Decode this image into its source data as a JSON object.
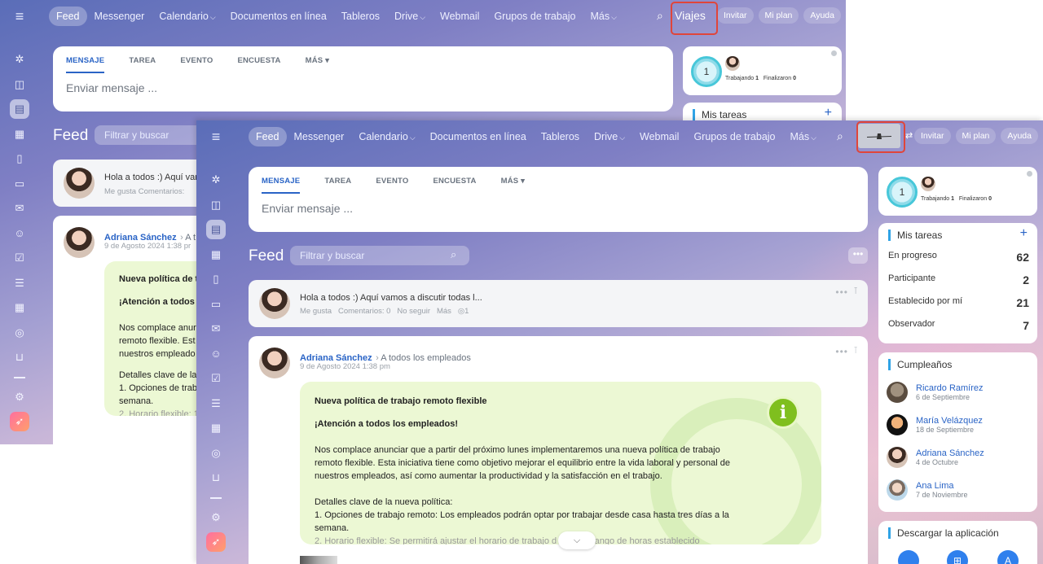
{
  "nav": {
    "items": [
      "Feed",
      "Messenger",
      "Calendario",
      "Documentos en línea",
      "Tableros",
      "Drive",
      "Webmail",
      "Grupos de trabajo",
      "Más"
    ],
    "invitar": "Invitar",
    "mi_plan": "Mi plan",
    "ayuda": "Ayuda"
  },
  "back_logo": "Viajes",
  "composer": {
    "tabs": [
      "MENSAJE",
      "TAREA",
      "EVENTO",
      "ENCUESTA",
      "MÁS"
    ],
    "placeholder": "Enviar mensaje ..."
  },
  "feed": {
    "title": "Feed",
    "filter_placeholder": "Filtrar y buscar"
  },
  "pinned_post": {
    "text": "Hola a todos :) Aquí vamos a discutir todas l...",
    "text_back": "Hola a todos :) Aquí var",
    "meta_back": "Me gusta   Comentarios:",
    "me_gusta": "Me gusta",
    "comentarios": "Comentarios: 0",
    "no_seguir": "No seguir",
    "mas": "Más",
    "views": "1"
  },
  "post": {
    "author": "Adriana Sánchez",
    "recipient": "A todos los empleados",
    "recipient_back": "A t",
    "date": "9 de Agosto 2024 1:38 pm",
    "date_back": "9 de Agosto 2024 1:38 pr",
    "heading": "Nueva política de trabajo remoto flexible",
    "heading_back": "Nueva política de t",
    "attention": "¡Atención a todos los empleados!",
    "attention_back": "¡Atención a todos",
    "para1": "Nos complace anunciar que a partir del próximo lunes implementaremos una nueva política de trabajo remoto flexible. Esta iniciativa tiene como objetivo mejorar el equilibrio entre la vida laboral y personal de nuestros empleados, así como aumentar la productividad y la satisfacción en el trabajo.",
    "para1_back": [
      "Nos complace anur",
      "remoto flexible. Est",
      "nuestros empleado"
    ],
    "details_label": "Detalles clave de la nueva política:",
    "details_back": "Detalles clave de la",
    "item1": "1. Opciones de trabajo remoto: Los empleados podrán optar por trabajar desde casa hasta tres días a la semana.",
    "item1_back": [
      "1. Opciones de trab",
      "semana."
    ],
    "item2_partial": "2. Horario flexible: Se permitirá ajustar el horario de trabajo d",
    "item2_tail": "un rango de horas establecido",
    "item2_back": "2. Horario flexible: 1"
  },
  "status": {
    "count": "1",
    "trabajando_label": "Trabajando",
    "trabajando_val": "1",
    "finalizaron_label": "Finalizaron",
    "finalizaron_val": "0"
  },
  "tasks": {
    "title": "Mis tareas",
    "add": "+",
    "rows": [
      {
        "label": "En progreso",
        "value": "62"
      },
      {
        "label": "Participante",
        "value": "2"
      },
      {
        "label": "Establecido por mí",
        "value": "21"
      },
      {
        "label": "Observador",
        "value": "7"
      }
    ]
  },
  "birthdays": {
    "title": "Cumpleaños",
    "people": [
      {
        "name": "Ricardo Ramírez",
        "date": "6 de Septiembre"
      },
      {
        "name": "María Velázquez",
        "date": "18 de Septiembre"
      },
      {
        "name": "Adriana Sánchez",
        "date": "4 de Octubre"
      },
      {
        "name": "Ana Lima",
        "date": "7 de Noviembre"
      }
    ]
  },
  "app_download": {
    "title": "Descargar la aplicación"
  },
  "colors": {
    "accent": "#2a64c6",
    "highlight": "#e0453a",
    "green": "#7fbf1e"
  }
}
